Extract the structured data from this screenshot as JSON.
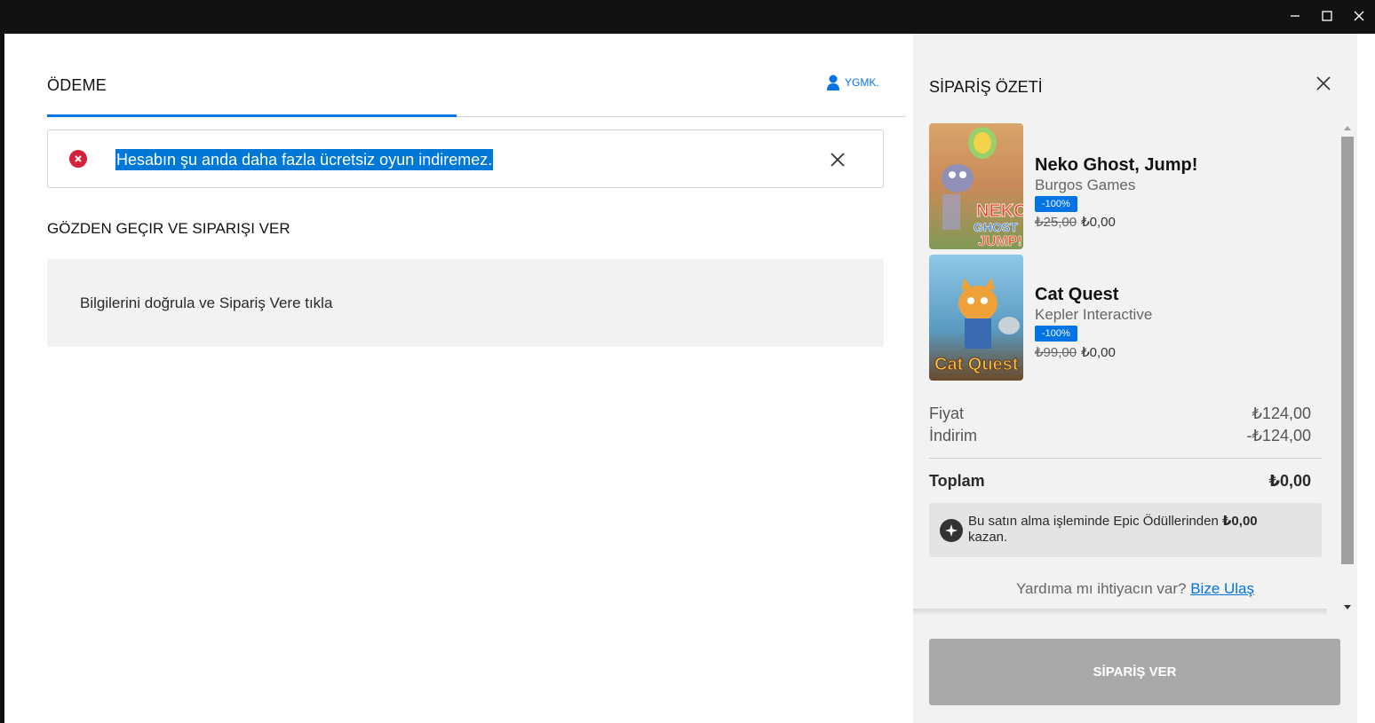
{
  "window": {
    "controls": [
      "minimize",
      "maximize",
      "close"
    ]
  },
  "checkout": {
    "title": "ÖDEME",
    "user": "YGMK.",
    "error_message": "Hesabın şu anda daha fazla ücretsiz oyun indiremez.",
    "review_title": "GÖZDEN GEÇIR VE SIPARIŞI VER",
    "review_info": "Bilgilerini doğrula ve Sipariş Vere tıkla"
  },
  "summary": {
    "title": "SİPARİŞ ÖZETİ",
    "items": [
      {
        "name": "Neko Ghost, Jump!",
        "publisher": "Burgos Games",
        "discount": "-100%",
        "old_price": "₺25,00",
        "price": "₺0,00"
      },
      {
        "name": "Cat Quest",
        "publisher": "Kepler Interactive",
        "discount": "-100%",
        "old_price": "₺99,00",
        "price": "₺0,00"
      }
    ],
    "price_label": "Fiyat",
    "price_value": "₺124,00",
    "discount_label": "İndirim",
    "discount_value": "-₺124,00",
    "total_label": "Toplam",
    "total_value": "₺0,00",
    "reward_text_prefix": "Bu satın alma işleminde Epic Ödüllerinden",
    "reward_amount": "₺0,00",
    "reward_text_suffix": "kazan.",
    "help_text": "Yardıma mı ihtiyacın var?",
    "help_link": "Bize Ulaş",
    "order_button": "SİPARİŞ VER"
  },
  "colors": {
    "accent": "#0074e4",
    "error": "#d6213a",
    "disabled_button": "#a9a9a9"
  }
}
